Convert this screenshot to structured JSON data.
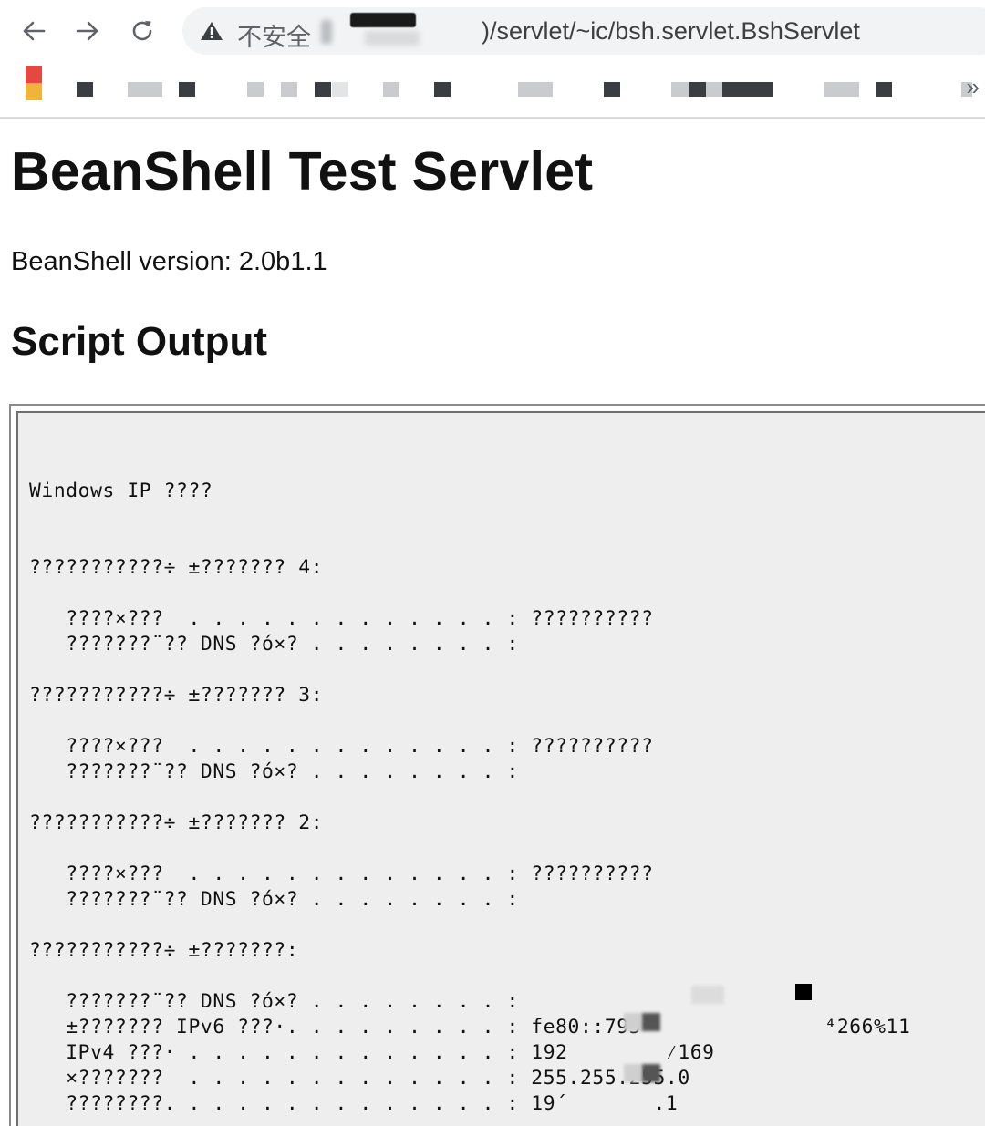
{
  "browser": {
    "security_label": "不安全",
    "url_visible": ")/servlet/~ic/bsh.servlet.BshServlet",
    "chevron": "»"
  },
  "page": {
    "title": "BeanShell Test Servlet",
    "version_text": "BeanShell version: 2.0b1.1",
    "section_title": "Script Output"
  },
  "output_lines": [
    "",
    "Windows IP ????",
    "",
    "",
    "???????????÷ ±??????? 4:",
    "",
    "   ????×???  . . . . . . . . . . . . . : ??????????",
    "   ???????¨?? DNS ?ó×? . . . . . . . . :",
    "",
    "???????????÷ ±??????? 3:",
    "",
    "   ????×???  . . . . . . . . . . . . . : ??????????",
    "   ???????¨?? DNS ?ó×? . . . . . . . . :",
    "",
    "???????????÷ ±??????? 2:",
    "",
    "   ????×???  . . . . . . . . . . . . . : ??????????",
    "   ???????¨?? DNS ?ó×? . . . . . . . . :",
    "",
    "???????????÷ ±???????:",
    "",
    "   ???????¨?? DNS ?ó×? . . . . . . . . :",
    "   ±??????? IPv6 ???·. . . . . . . . . : fe80::795⁴              ⁴266%11",
    "   IPv4 ???· . . . . . . . . . . . . . : 192        ⁄169",
    "   ×???????  . . . . . . . . . . . . . : 255.255.255.0",
    "   ????????. . . . . . . . . . . . . . : 19´       .1"
  ]
}
